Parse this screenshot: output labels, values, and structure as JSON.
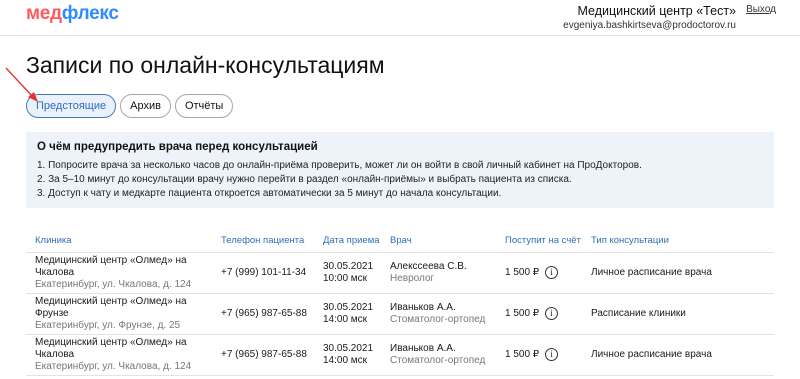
{
  "header": {
    "logo_part1": "мед",
    "logo_part2": "флекс",
    "org_name": "Медицинский центр «Тест»",
    "user_email": "evgeniya.bashkirtseva@prodoctorov.ru",
    "logout_label": "Выход"
  },
  "page_title": "Записи по онлайн-консультациям",
  "tabs": [
    {
      "label": "Предстоящие",
      "active": true
    },
    {
      "label": "Архив",
      "active": false
    },
    {
      "label": "Отчёты",
      "active": false
    }
  ],
  "notice": {
    "heading": "О чём предупредить врача перед консультацией",
    "lines": [
      "1. Попросите врача за несколько часов до онлайн-приёма проверить, может ли он войти в свой личный кабинет на ПроДокторов.",
      "2. За 5–10 минут до консультации врачу нужно перейти в раздел «онлайн-приёмы» и выбрать пациента из списка.",
      "3. Доступ к чату и медкарте пациента откроется автоматически за 5 минут до начала консультации."
    ]
  },
  "table": {
    "headers": [
      "Клиника",
      "Телефон пациента",
      "Дата приема",
      "Врач",
      "Поступит на счёт",
      "Тип консультации"
    ],
    "rows": [
      {
        "clinic": "Медицинский центр «Олмед» на Чкалова",
        "address": "Екатеринбург, ул. Чкалова, д. 124",
        "phone": "+7 (999) 101-11-34",
        "date": "30.05.2021",
        "time": "10:00 мск",
        "doctor": "Алекссеева С.В.",
        "specialty": "Невролог",
        "amount": "1 500 ₽",
        "type": "Личное расписание врача"
      },
      {
        "clinic": "Медицинский центр «Олмед» на Фрунзе",
        "address": "Екатеринбург, ул. Фрунзе, д. 25",
        "phone": "+7 (965) 987-65-88",
        "date": "30.05.2021",
        "time": "14:00 мск",
        "doctor": "Иваньков А.А.",
        "specialty": "Стоматолог-ортопед",
        "amount": "1 500 ₽",
        "type": "Расписание клиники"
      },
      {
        "clinic": "Медицинский центр «Олмед» на Чкалова",
        "address": "Екатеринбург, ул. Чкалова, д. 124",
        "phone": "+7 (965) 987-65-88",
        "date": "30.05.2021",
        "time": "14:00 мск",
        "doctor": "Иваньков А.А.",
        "specialty": "Стоматолог-ортопед",
        "amount": "1 500 ₽",
        "type": "Личное расписание врача"
      }
    ],
    "info_glyph": "i"
  },
  "colors": {
    "accent": "#2d6cc2",
    "logo_red": "#ff5a5f",
    "logo_blue": "#2f8cff",
    "annotation_arrow": "#e5322d"
  }
}
